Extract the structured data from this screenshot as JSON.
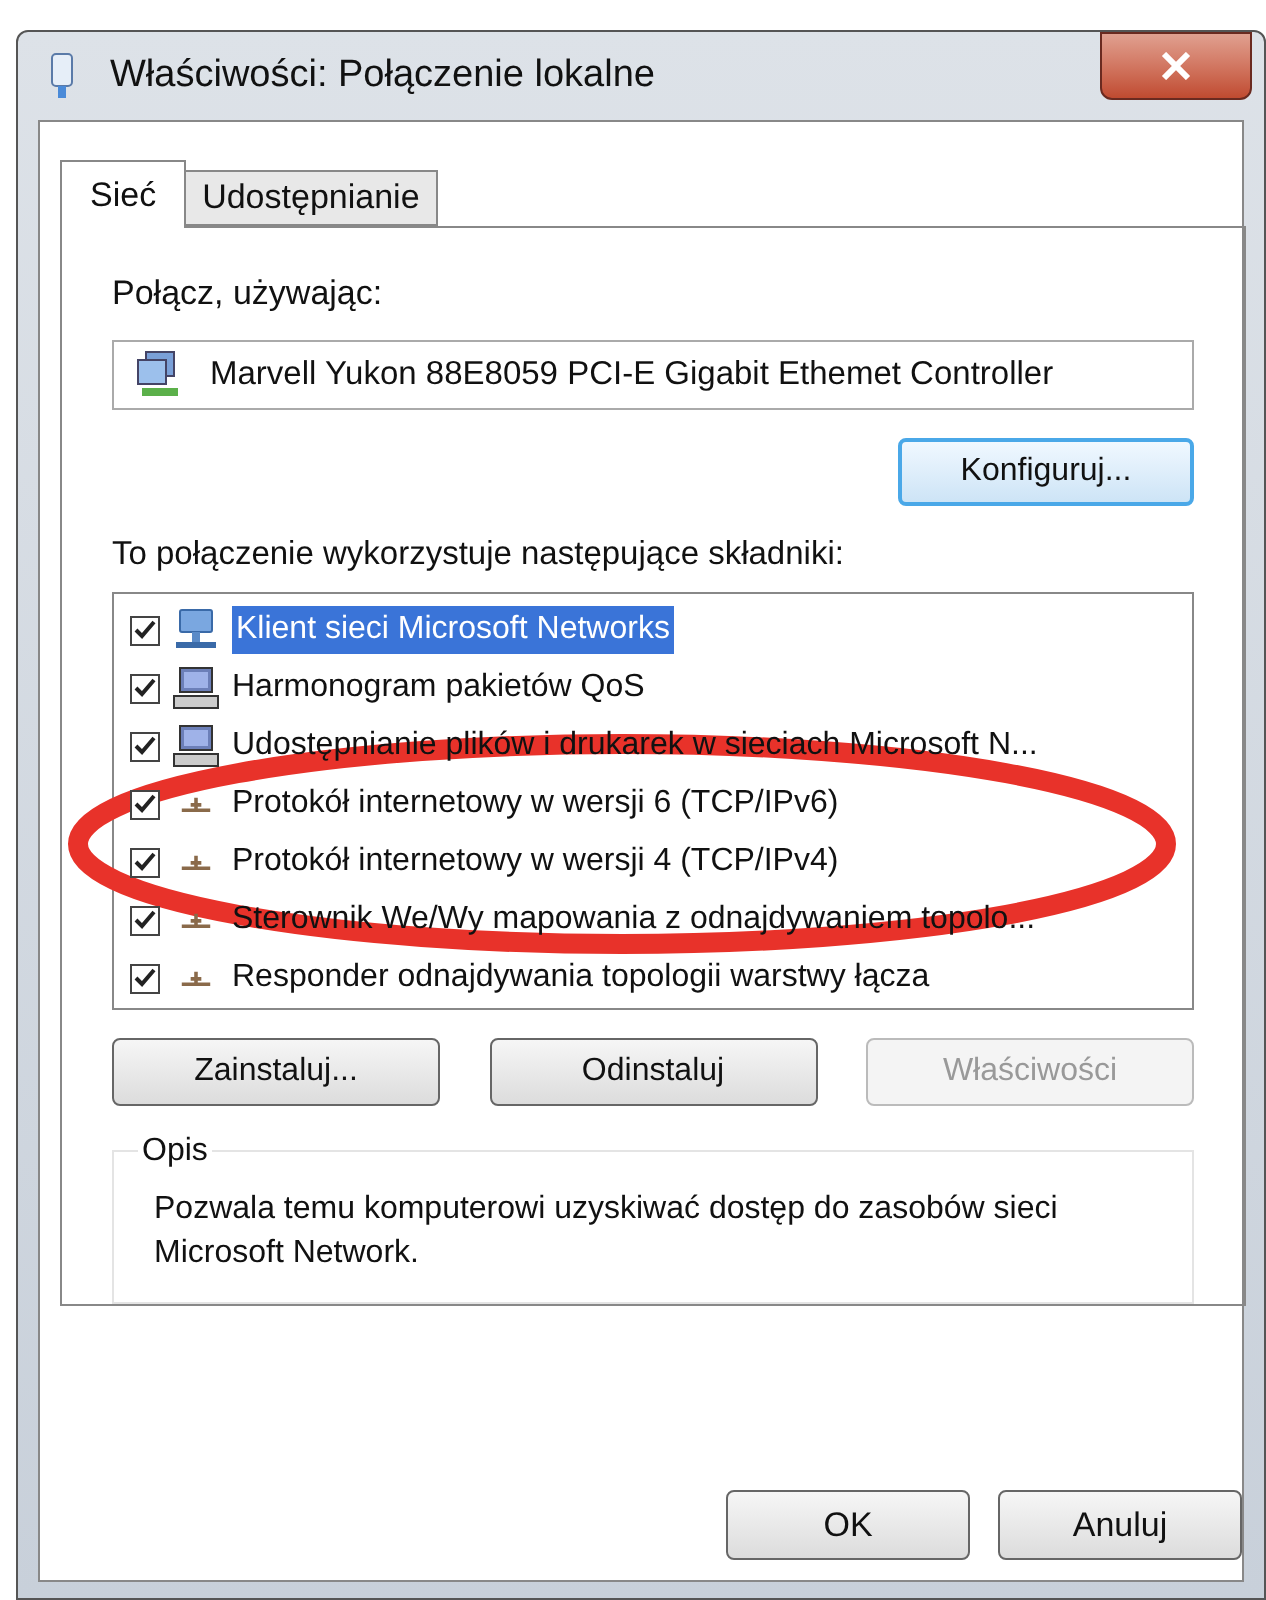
{
  "window": {
    "title": "Właściwości: Połączenie lokalne"
  },
  "tabs": [
    {
      "label": "Sieć",
      "selected": true
    },
    {
      "label": "Udostępnianie",
      "selected": false
    }
  ],
  "connect_label": "Połącz, używając:",
  "adapter": {
    "name": "Marvell Yukon 88E8059 PCI-E Gigabit Ethemet Controller"
  },
  "configure_button": {
    "label": "Konfiguruj..."
  },
  "components_label": {
    "label": "To połączenie wykorzystuje następujące składniki:"
  },
  "components": [
    {
      "label": "Klient sieci Microsoft Networks",
      "checked": true,
      "selected": true,
      "kind": "client"
    },
    {
      "label": "Harmonogram pakietów QoS",
      "checked": true,
      "selected": false,
      "kind": "service"
    },
    {
      "label": "Udostępnianie plików i drukarek w sieciach Microsoft N...",
      "checked": true,
      "selected": false,
      "kind": "service"
    },
    {
      "label": "Protokół internetowy w wersji 6 (TCP/IPv6)",
      "checked": true,
      "selected": false,
      "kind": "protocol"
    },
    {
      "label": "Protokół internetowy w wersji 4 (TCP/IPv4)",
      "checked": true,
      "selected": false,
      "kind": "protocol"
    },
    {
      "label": "Sterownik We/Wy mapowania z odnajdywaniem topolo...",
      "checked": true,
      "selected": false,
      "kind": "protocol"
    },
    {
      "label": "Responder odnajdywania topologii warstwy łącza",
      "checked": true,
      "selected": false,
      "kind": "protocol"
    }
  ],
  "component_buttons": [
    {
      "label": "Zainstaluj...",
      "disabled": false
    },
    {
      "label": "Odinstaluj",
      "disabled": false
    },
    {
      "label": "Właściwości",
      "disabled": true
    }
  ],
  "description": {
    "title": "Opis",
    "text": "Pozwala temu komputerowi uzyskiwać dostęp do zasobów sieci Microsoft Network."
  },
  "dialog_buttons": [
    {
      "label": "OK"
    },
    {
      "label": "Anuluj"
    }
  ]
}
